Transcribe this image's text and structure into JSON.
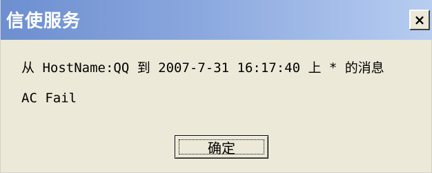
{
  "window": {
    "title": "信使服务",
    "close_label": "×"
  },
  "message": {
    "header": "从 HostName:QQ 到 2007-7-31 16:17:40 上 * 的消息",
    "body": "AC Fail"
  },
  "buttons": {
    "ok_label": "确定"
  }
}
